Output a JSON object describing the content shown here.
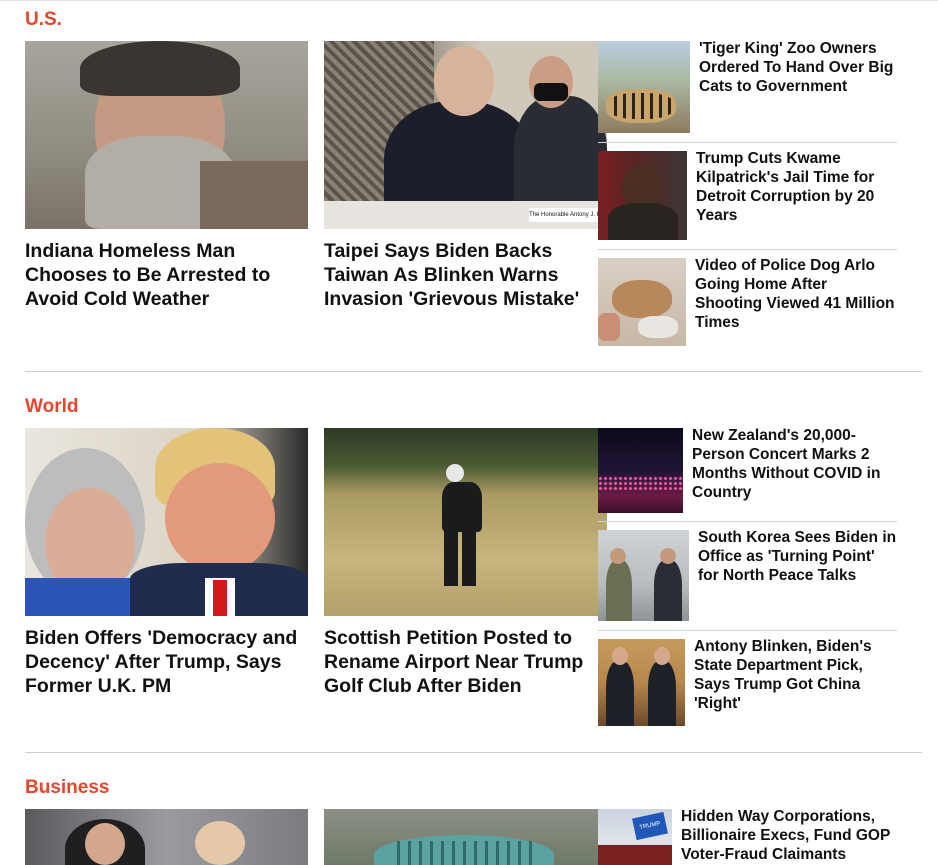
{
  "sections": [
    {
      "title": "U.S.",
      "featured": [
        {
          "headline": "Indiana Homeless Man Chooses to Be Arrested to Avoid Cold Weather"
        },
        {
          "headline": "Taipei Says Biden Backs Taiwan As Blinken Warns Invasion 'Grievous Mistake'"
        }
      ],
      "side": [
        {
          "headline": "'Tiger King' Zoo Owners Ordered To Hand Over Big Cats to Government"
        },
        {
          "headline": "Trump Cuts Kwame Kilpatrick's Jail Time for Detroit Corruption by 20 Years"
        },
        {
          "headline": "Video of Police Dog Arlo Going Home After Shooting Viewed 41 Million Times"
        }
      ]
    },
    {
      "title": "World",
      "featured": [
        {
          "headline": "Biden Offers 'Democracy and Decency' After Trump, Says Former U.K. PM"
        },
        {
          "headline": "Scottish Petition Posted to Rename Airport Near Trump Golf Club After Biden"
        }
      ],
      "side": [
        {
          "headline": "New Zealand's 20,000-Person Concert Marks 2 Months Without COVID in Country"
        },
        {
          "headline": "South Korea Sees Biden in Office as 'Turning Point' for North Peace Talks"
        },
        {
          "headline": "Antony Blinken, Biden's State Department Pick, Says Trump Got China 'Right'"
        }
      ]
    },
    {
      "title": "Business",
      "side": [
        {
          "headline": "Hidden Way Corporations, Billionaire Execs, Fund GOP Voter-Fraud Claimants"
        }
      ]
    }
  ],
  "photo_captions": {
    "senate_placard": "The Honorable Antony J. Blinken",
    "trump_sign": "TRUMP"
  },
  "colors": {
    "section_title": "#e8452c",
    "divider": "#cfcfcf"
  }
}
